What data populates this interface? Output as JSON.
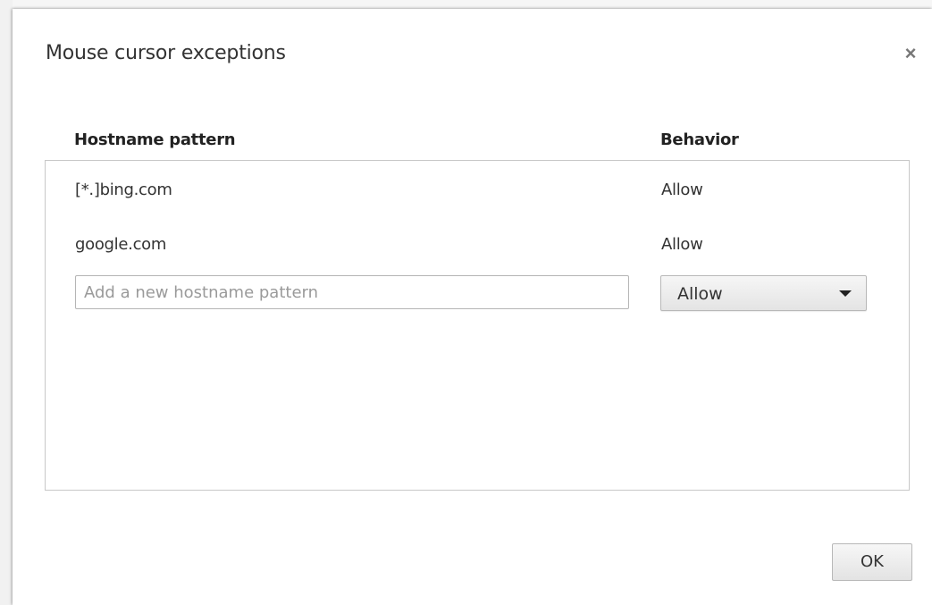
{
  "dialog": {
    "title": "Mouse cursor exceptions",
    "close_icon": "close-icon"
  },
  "table": {
    "headers": {
      "hostname": "Hostname pattern",
      "behavior": "Behavior"
    },
    "rows": [
      {
        "pattern": "[*.]bing.com",
        "behavior": "Allow"
      },
      {
        "pattern": "google.com",
        "behavior": "Allow"
      }
    ],
    "new_entry": {
      "placeholder": "Add a new hostname pattern",
      "value": "",
      "behavior_selected": "Allow"
    }
  },
  "footer": {
    "ok_label": "OK"
  }
}
